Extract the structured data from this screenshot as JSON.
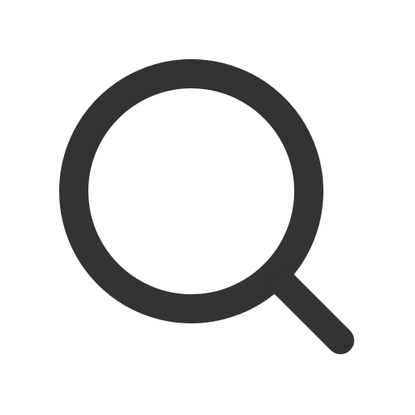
{
  "icon": {
    "name": "search-icon",
    "stroke_color": "#333333",
    "background_color": "#ffffff"
  }
}
